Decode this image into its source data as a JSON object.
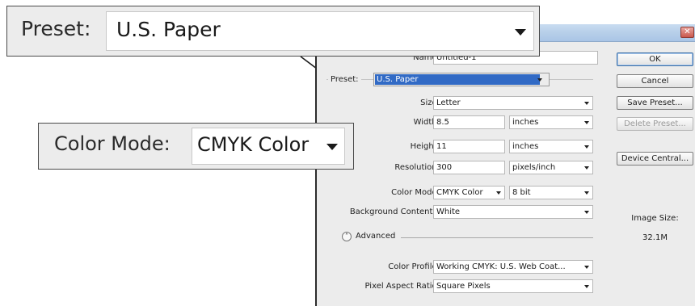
{
  "callouts": {
    "preset": {
      "label": "Preset:",
      "value": "U.S. Paper"
    },
    "color_mode": {
      "label": "Color Mode:",
      "value": "CMYK Color"
    }
  },
  "dialog": {
    "close_glyph": "✕",
    "name": {
      "label": "Name:",
      "value": "Untitled-1"
    },
    "preset": {
      "label": "Preset:",
      "value": "U.S. Paper"
    },
    "size": {
      "label": "Size:",
      "value": "Letter"
    },
    "width": {
      "label": "Width:",
      "value": "8.5",
      "unit": "inches"
    },
    "height": {
      "label": "Height:",
      "value": "11",
      "unit": "inches"
    },
    "resolution": {
      "label": "Resolution:",
      "value": "300",
      "unit": "pixels/inch"
    },
    "color_mode": {
      "label": "Color Mode:",
      "value": "CMYK Color",
      "depth": "8 bit"
    },
    "background": {
      "label": "Background Contents:",
      "value": "White"
    },
    "advanced": {
      "label": "Advanced"
    },
    "color_profile": {
      "label": "Color Profile:",
      "value": "Working CMYK:  U.S. Web Coat..."
    },
    "pixel_aspect": {
      "label": "Pixel Aspect Ratio:",
      "value": "Square Pixels"
    },
    "buttons": {
      "ok": "OK",
      "cancel": "Cancel",
      "save_preset": "Save Preset...",
      "delete_preset": "Delete Preset...",
      "device_central": "Device Central..."
    },
    "image_size": {
      "label": "Image Size:",
      "value": "32.1M"
    }
  },
  "colors": {
    "titlebar": "#b7cfe9",
    "selection": "#316ac5",
    "dialog_bg": "#ececec"
  }
}
